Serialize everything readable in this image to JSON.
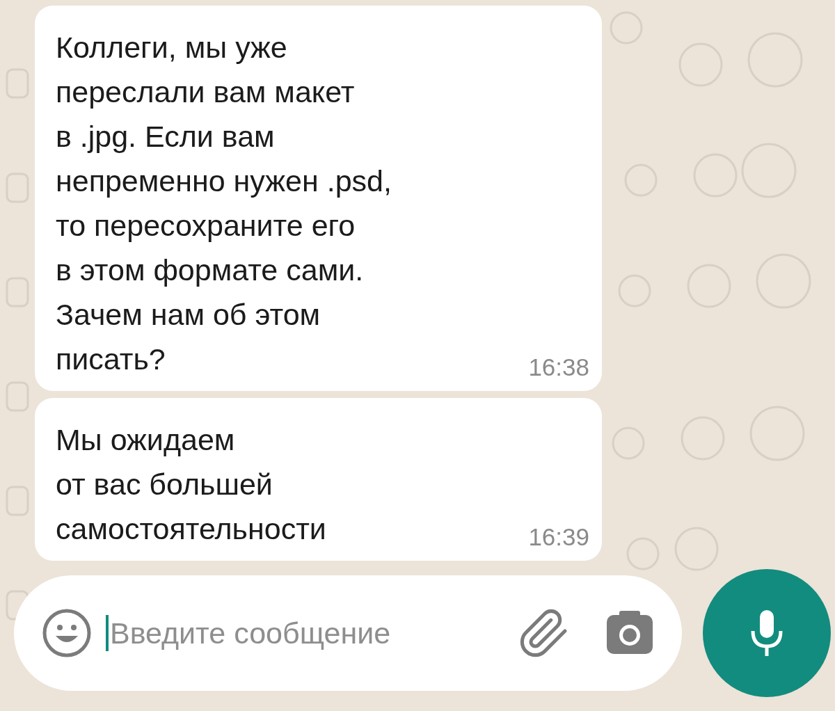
{
  "messages": [
    {
      "text": "Коллеги, мы уже\nпереслали вам макет\nв .jpg. Если вам\nнепременно нужен .psd,\nто пересохраните его\nв этом формате сами.\nЗачем нам об этом\nписать?",
      "time": "16:38"
    },
    {
      "text": "Мы ожидаем\nот вас большей\nсамостоятельности",
      "time": "16:39"
    }
  ],
  "composer": {
    "placeholder": "Введите сообщение"
  }
}
